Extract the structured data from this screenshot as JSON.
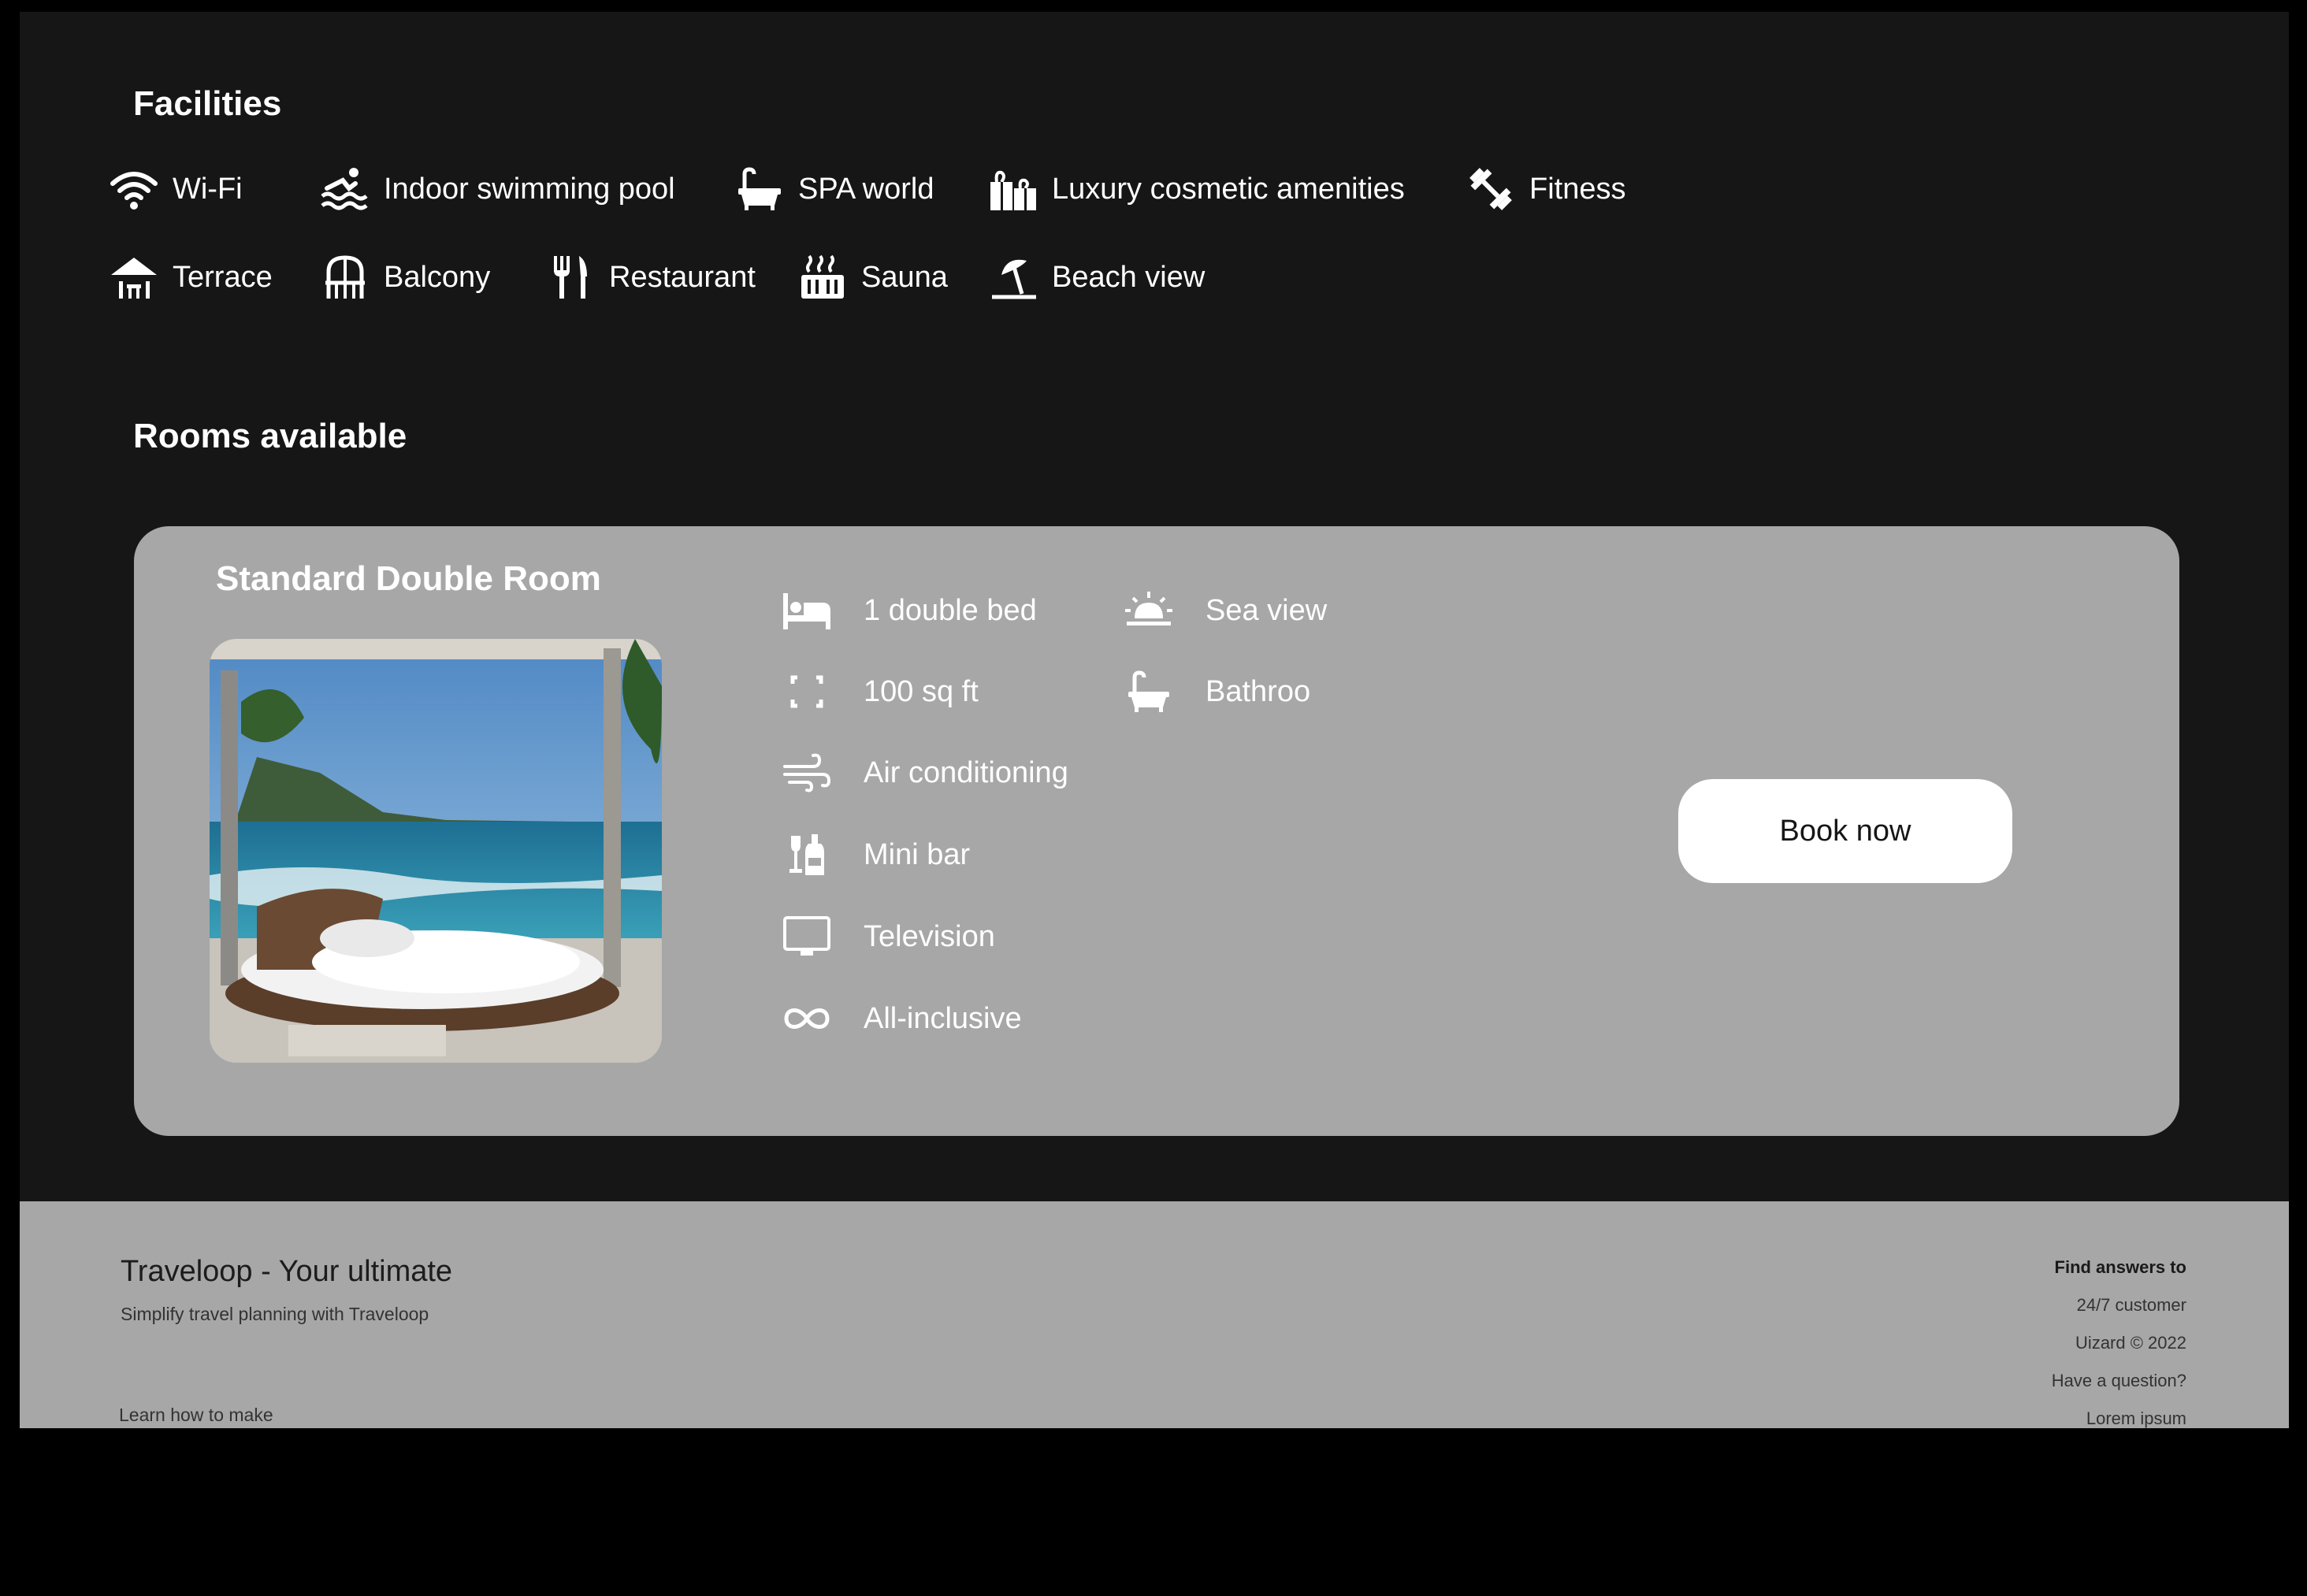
{
  "facilities": {
    "title": "Facilities",
    "items": [
      {
        "label": "Wi-Fi",
        "icon": "wifi-icon"
      },
      {
        "label": "Indoor swimming pool",
        "icon": "swimming-icon"
      },
      {
        "label": "SPA world",
        "icon": "bathtub-icon"
      },
      {
        "label": "Luxury cosmetic amenities",
        "icon": "gift-icon"
      },
      {
        "label": "Fitness",
        "icon": "dumbbell-icon"
      },
      {
        "label": "Terrace",
        "icon": "terrace-icon"
      },
      {
        "label": "Balcony",
        "icon": "balcony-icon"
      },
      {
        "label": "Restaurant",
        "icon": "utensils-icon"
      },
      {
        "label": "Sauna",
        "icon": "sauna-icon"
      },
      {
        "label": "Beach view",
        "icon": "umbrella-beach-icon"
      }
    ]
  },
  "rooms": {
    "title": "Rooms available",
    "room": {
      "name": "Standard Double Room",
      "photo_alt": "Round bed facing the sea",
      "features_left": [
        {
          "label": "1 double bed",
          "icon": "bed-icon"
        },
        {
          "label": "100 sq ft",
          "icon": "expand-icon"
        },
        {
          "label": "Air conditioning",
          "icon": "wind-icon"
        },
        {
          "label": "Mini bar",
          "icon": "wine-bottle-icon"
        },
        {
          "label": "Television",
          "icon": "tv-icon"
        },
        {
          "label": "All-inclusive",
          "icon": "infinity-icon"
        }
      ],
      "features_right": [
        {
          "label": "Sea view",
          "icon": "sunrise-icon"
        },
        {
          "label": "Bathroo",
          "icon": "bathtub-icon"
        }
      ],
      "book_label": "Book now"
    }
  },
  "footer": {
    "brand": "Traveloop - Your ultimate",
    "tagline": "Simplify travel planning with Traveloop",
    "learn": "Learn how to make",
    "links": [
      "Find answers to",
      "24/7 customer",
      "Uizard © 2022",
      "Have a question?",
      "Lorem ipsum"
    ]
  },
  "colors": {
    "page_bg": "#000000",
    "panel_bg": "#161616",
    "card_bg": "#a7a7a7",
    "button_bg": "#ffffff",
    "text": "#ffffff"
  }
}
